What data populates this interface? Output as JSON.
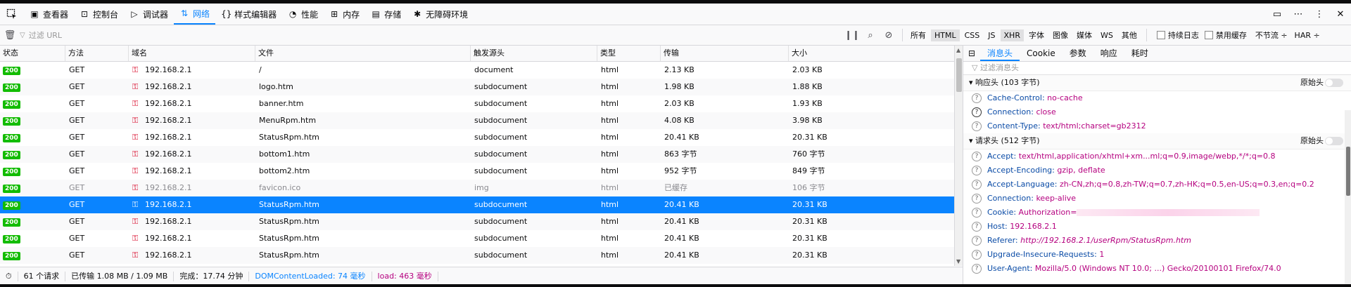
{
  "toolbox": {
    "tabs": [
      {
        "label": "查看器",
        "icon": "inspector-icon"
      },
      {
        "label": "控制台",
        "icon": "console-icon"
      },
      {
        "label": "调试器",
        "icon": "debugger-icon"
      },
      {
        "label": "网络",
        "icon": "network-icon"
      },
      {
        "label": "样式编辑器",
        "icon": "style-editor-icon"
      },
      {
        "label": "性能",
        "icon": "performance-icon"
      },
      {
        "label": "内存",
        "icon": "memory-icon"
      },
      {
        "label": "存储",
        "icon": "storage-icon"
      },
      {
        "label": "无障碍环境",
        "icon": "accessibility-icon"
      }
    ],
    "selected_tab": "网络",
    "accent": "#0a84ff"
  },
  "filterbar": {
    "placeholder": "过滤 URL",
    "types": [
      "所有",
      "HTML",
      "CSS",
      "JS",
      "XHR",
      "字体",
      "图像",
      "媒体",
      "WS",
      "其他"
    ],
    "active_types": [
      "HTML",
      "XHR"
    ],
    "persist_logs_label": "持续日志",
    "disable_cache_label": "禁用缓存",
    "throttle_label": "不节流 ÷",
    "har_label": "HAR ÷"
  },
  "table": {
    "columns": [
      "状态",
      "方法",
      "域名",
      "文件",
      "触发源头",
      "类型",
      "传输",
      "大小"
    ],
    "rows": [
      {
        "status": "200",
        "method": "GET",
        "domain": "192.168.2.1",
        "file": "/",
        "cause": "document",
        "type": "html",
        "transferred": "2.13 KB",
        "size": "2.03 KB"
      },
      {
        "status": "200",
        "method": "GET",
        "domain": "192.168.2.1",
        "file": "logo.htm",
        "cause": "subdocument",
        "type": "html",
        "transferred": "1.98 KB",
        "size": "1.88 KB"
      },
      {
        "status": "200",
        "method": "GET",
        "domain": "192.168.2.1",
        "file": "banner.htm",
        "cause": "subdocument",
        "type": "html",
        "transferred": "2.03 KB",
        "size": "1.93 KB"
      },
      {
        "status": "200",
        "method": "GET",
        "domain": "192.168.2.1",
        "file": "MenuRpm.htm",
        "cause": "subdocument",
        "type": "html",
        "transferred": "4.08 KB",
        "size": "3.98 KB"
      },
      {
        "status": "200",
        "method": "GET",
        "domain": "192.168.2.1",
        "file": "StatusRpm.htm",
        "cause": "subdocument",
        "type": "html",
        "transferred": "20.41 KB",
        "size": "20.31 KB"
      },
      {
        "status": "200",
        "method": "GET",
        "domain": "192.168.2.1",
        "file": "bottom1.htm",
        "cause": "subdocument",
        "type": "html",
        "transferred": "863 字节",
        "size": "760 字节"
      },
      {
        "status": "200",
        "method": "GET",
        "domain": "192.168.2.1",
        "file": "bottom2.htm",
        "cause": "subdocument",
        "type": "html",
        "transferred": "952 字节",
        "size": "849 字节"
      },
      {
        "status": "200",
        "method": "GET",
        "domain": "192.168.2.1",
        "file": "favicon.ico",
        "cause": "img",
        "type": "html",
        "transferred": "已缓存",
        "size": "106 字节"
      },
      {
        "status": "200",
        "method": "GET",
        "domain": "192.168.2.1",
        "file": "StatusRpm.htm",
        "cause": "subdocument",
        "type": "html",
        "transferred": "20.41 KB",
        "size": "20.31 KB"
      },
      {
        "status": "200",
        "method": "GET",
        "domain": "192.168.2.1",
        "file": "StatusRpm.htm",
        "cause": "subdocument",
        "type": "html",
        "transferred": "20.41 KB",
        "size": "20.31 KB"
      },
      {
        "status": "200",
        "method": "GET",
        "domain": "192.168.2.1",
        "file": "StatusRpm.htm",
        "cause": "subdocument",
        "type": "html",
        "transferred": "20.41 KB",
        "size": "20.31 KB"
      },
      {
        "status": "200",
        "method": "GET",
        "domain": "192.168.2.1",
        "file": "StatusRpm.htm",
        "cause": "subdocument",
        "type": "html",
        "transferred": "20.41 KB",
        "size": "20.31 KB"
      }
    ],
    "selected_row": 8,
    "cached_row": 7
  },
  "statusbar": {
    "requests": "61 个请求",
    "transferred": "已传输 1.08 MB / 1.09 MB",
    "finish": "完成：17.74 分钟",
    "dom": "DOMContentLoaded: 74 毫秒",
    "load": "load: 463 毫秒"
  },
  "panel": {
    "tabs": [
      "消息头",
      "Cookie",
      "参数",
      "响应",
      "耗时"
    ],
    "selected_tab": "消息头",
    "filter_placeholder": "过滤消息头",
    "raw_label": "原始头",
    "response_section": "响应头 (103 字节)",
    "response_headers": [
      {
        "name": "Cache-Control:",
        "value": "no-cache"
      },
      {
        "name": "Connection:",
        "value": "close"
      },
      {
        "name": "Content-Type:",
        "value": "text/html;charset=gb2312"
      }
    ],
    "request_section": "请求头 (512 字节)",
    "request_headers": [
      {
        "name": "Accept:",
        "value": "text/html,application/xhtml+xm...ml;q=0.9,image/webp,*/*;q=0.8"
      },
      {
        "name": "Accept-Encoding:",
        "value": "gzip, deflate"
      },
      {
        "name": "Accept-Language:",
        "value": "zh-CN,zh;q=0.8,zh-TW;q=0.7,zh-HK;q=0.5,en-US;q=0.3,en;q=0.2"
      },
      {
        "name": "Connection:",
        "value": "keep-alive"
      },
      {
        "name": "Cookie:",
        "value": "Authorization="
      },
      {
        "name": "Host:",
        "value": "192.168.2.1"
      },
      {
        "name": "Referer:",
        "value": "http://192.168.2.1/userRpm/StatusRpm.htm"
      },
      {
        "name": "Upgrade-Insecure-Requests:",
        "value": "1"
      },
      {
        "name": "User-Agent:",
        "value": "Mozilla/5.0 (Windows NT 10.0; ...) Gecko/20100101 Firefox/74.0"
      }
    ]
  }
}
